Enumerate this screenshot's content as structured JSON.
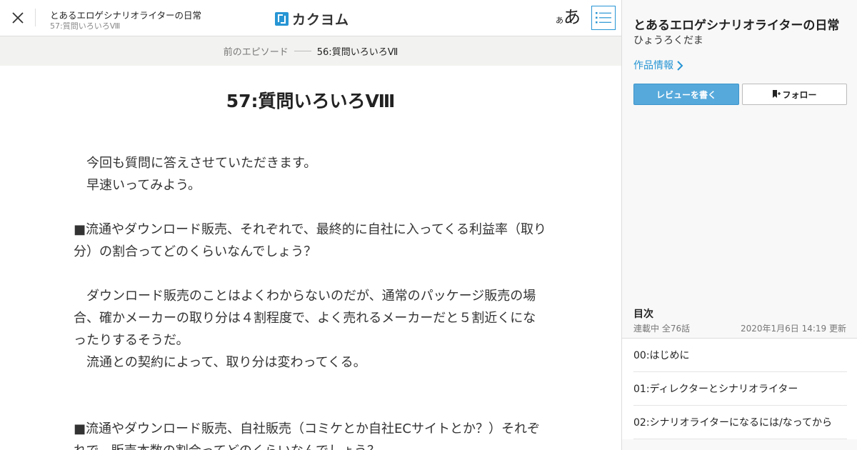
{
  "header": {
    "work_title": "とあるエロゲシナリオライターの日常",
    "episode_subtitle": "57:質問いろいろⅧ",
    "logo_text": "カクヨム",
    "font_small": "あ",
    "font_large": "あ",
    "icons": {
      "close": "close-icon",
      "toc": "list-icon"
    }
  },
  "episode_nav": {
    "prev_label": "前のエピソード",
    "current_label": "56:質問いろいろⅦ"
  },
  "episode": {
    "title": "57:質問いろいろⅧ",
    "paragraphs": [
      "　今回も質問に答えさせていただきます。",
      "　早速いってみよう。",
      "",
      "■流通やダウンロード販売、それぞれで、最終的に自社に入ってくる利益率（取り分）の割合ってどのくらいなんでしょう？",
      "",
      "　ダウンロード販売のことはよくわからないのだが、通常のパッケージ販売の場合、確かメーカーの取り分は４割程度で、よく売れるメーカーだと５割近くになったりするそうだ。",
      "　流通との契約によって、取り分は変わってくる。",
      "",
      "",
      "■流通やダウンロード販売、自社販売（コミケとか自社ECサイトとか？）それぞれで、販売本数の割合ってどのくらいなんでしょう？"
    ]
  },
  "sidebar": {
    "title": "とあるエロゲシナリオライターの日常",
    "author": "ひょうろくだま",
    "info_link": "作品情報",
    "review_button": "レビューを書く",
    "follow_button": "フォロー",
    "toc_heading": "目次",
    "toc_status": "連載中 全76話",
    "toc_updated": "2020年1月6日 14:19 更新",
    "toc_items": [
      {
        "label": "00:はじめに"
      },
      {
        "label": "01:ディレクターとシナリオライター"
      },
      {
        "label": "02:シナリオライターになるには/なってから"
      }
    ],
    "accent_color": "#2795d4"
  }
}
